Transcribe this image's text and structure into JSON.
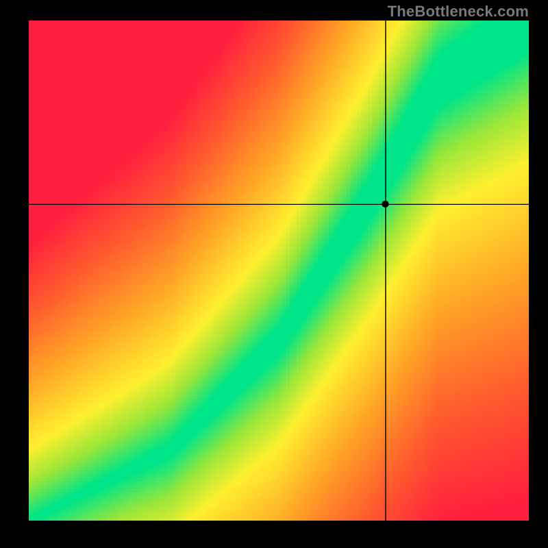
{
  "watermark": "TheBottleneck.com",
  "chart_data": {
    "type": "heatmap",
    "title": "",
    "xlabel": "",
    "ylabel": "",
    "xlim": [
      0,
      1
    ],
    "ylim": [
      0,
      1
    ],
    "ridge": {
      "description": "Optimal (green) band — piecewise-linear y(x) from bottom-left to top-right",
      "points": [
        {
          "x": 0.0,
          "y": 0.0
        },
        {
          "x": 0.28,
          "y": 0.14
        },
        {
          "x": 0.5,
          "y": 0.36
        },
        {
          "x": 0.68,
          "y": 0.64
        },
        {
          "x": 0.82,
          "y": 0.88
        },
        {
          "x": 1.0,
          "y": 1.0
        }
      ],
      "band_half_width": [
        {
          "x": 0.0,
          "w": 0.004
        },
        {
          "x": 0.2,
          "w": 0.01
        },
        {
          "x": 0.4,
          "w": 0.022
        },
        {
          "x": 0.6,
          "w": 0.035
        },
        {
          "x": 0.8,
          "w": 0.05
        },
        {
          "x": 1.0,
          "w": 0.06
        }
      ]
    },
    "background_gradient": {
      "description": "Distance from ridge mapped through red→orange→yellow→green",
      "stops": [
        {
          "t": 0.0,
          "color": "#00e589"
        },
        {
          "t": 0.12,
          "color": "#9ae73a"
        },
        {
          "t": 0.25,
          "color": "#fff030"
        },
        {
          "t": 0.5,
          "color": "#ffa227"
        },
        {
          "t": 0.75,
          "color": "#ff5a2f"
        },
        {
          "t": 1.0,
          "color": "#ff1f3f"
        }
      ]
    },
    "crosshair": {
      "x": 0.713,
      "y": 0.633,
      "marker_radius_px": 5
    },
    "grid_resolution": 140
  }
}
